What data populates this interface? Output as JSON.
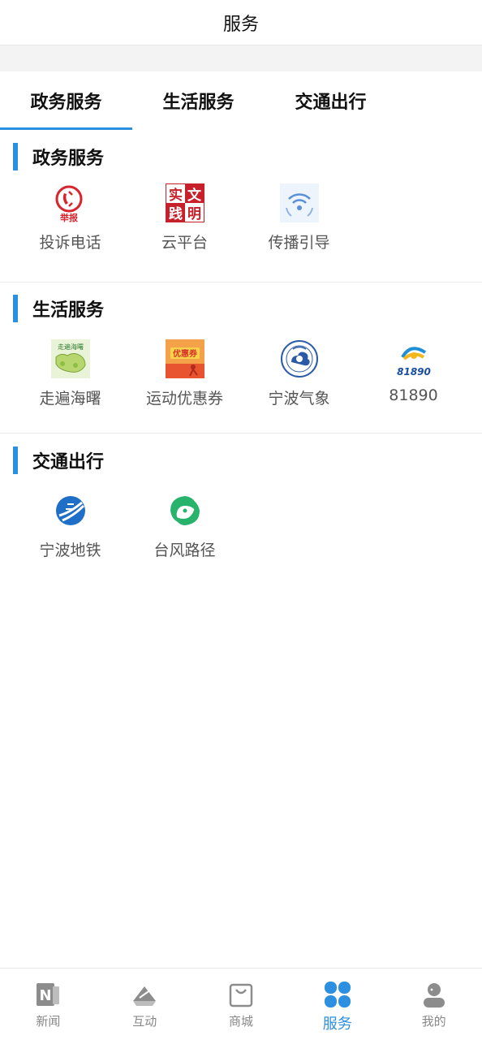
{
  "header": {
    "title": "服务"
  },
  "tabs": [
    {
      "label": "政务服务",
      "active": true
    },
    {
      "label": "生活服务",
      "active": false
    },
    {
      "label": "交通出行",
      "active": false
    }
  ],
  "sections": [
    {
      "title": "政务服务",
      "items": [
        {
          "label": "投诉电话",
          "icon": "report-phone-icon",
          "icon_text": "举报"
        },
        {
          "label": "云平台",
          "icon": "civilization-stamp-icon",
          "icon_text": [
            "实",
            "文",
            "践",
            "明"
          ]
        },
        {
          "label": "传播引导",
          "icon": "broadcast-signal-icon"
        }
      ]
    },
    {
      "title": "生活服务",
      "items": [
        {
          "label": "走遍海曙",
          "icon": "map-tour-icon",
          "icon_text": "走遍海曙"
        },
        {
          "label": "运动优惠券",
          "icon": "sports-coupon-icon",
          "icon_text": "优惠券"
        },
        {
          "label": "宁波气象",
          "icon": "weather-seal-icon"
        },
        {
          "label": "81890",
          "icon": "service-81890-icon",
          "icon_text": "81890"
        }
      ]
    },
    {
      "title": "交通出行",
      "items": [
        {
          "label": "宁波地铁",
          "icon": "metro-icon"
        },
        {
          "label": "台风路径",
          "icon": "typhoon-icon"
        }
      ]
    }
  ],
  "bottom_nav": [
    {
      "label": "新闻",
      "icon": "news-icon",
      "active": false
    },
    {
      "label": "互动",
      "icon": "interaction-icon",
      "active": false
    },
    {
      "label": "商城",
      "icon": "shop-bag-icon",
      "active": false
    },
    {
      "label": "服务",
      "icon": "service-grid-icon",
      "active": true
    },
    {
      "label": "我的",
      "icon": "profile-icon",
      "active": false
    }
  ],
  "colors": {
    "accent": "#2d8fe0",
    "text": "#111111",
    "label": "#555555",
    "nav_inactive": "#888888"
  }
}
